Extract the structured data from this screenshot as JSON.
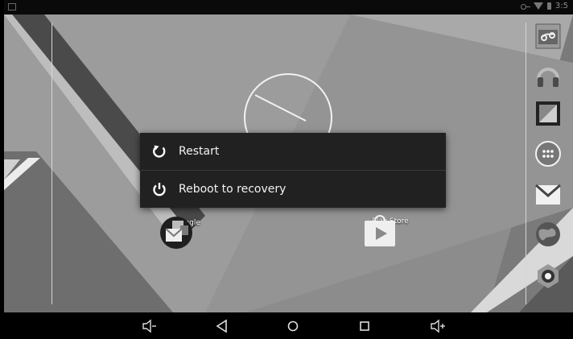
{
  "status_bar": {
    "time": "3:5",
    "icons": [
      "notification-icon",
      "vpn-key-icon",
      "wifi-icon",
      "battery-icon"
    ]
  },
  "power_menu": {
    "items": [
      {
        "label": "Restart",
        "icon": "restart-icon"
      },
      {
        "label": "Reboot to recovery",
        "icon": "power-icon"
      }
    ]
  },
  "home_apps": [
    {
      "label": "Google",
      "icon": "google-folder-icon"
    },
    {
      "label": "Play Store",
      "icon": "play-store-icon"
    }
  ],
  "dock_apps": [
    {
      "icon": "photo-frame-icon"
    },
    {
      "icon": "headphones-music-icon"
    },
    {
      "icon": "gallery-icon"
    },
    {
      "icon": "app-drawer-icon"
    },
    {
      "icon": "gmail-icon"
    },
    {
      "icon": "globe-browser-icon"
    },
    {
      "icon": "camera-icon"
    }
  ],
  "nav_bar": {
    "buttons": [
      "volume-down-icon",
      "back-icon",
      "home-icon",
      "recents-icon",
      "volume-up-icon"
    ]
  },
  "clock_widget": {
    "type": "analog-clock"
  }
}
